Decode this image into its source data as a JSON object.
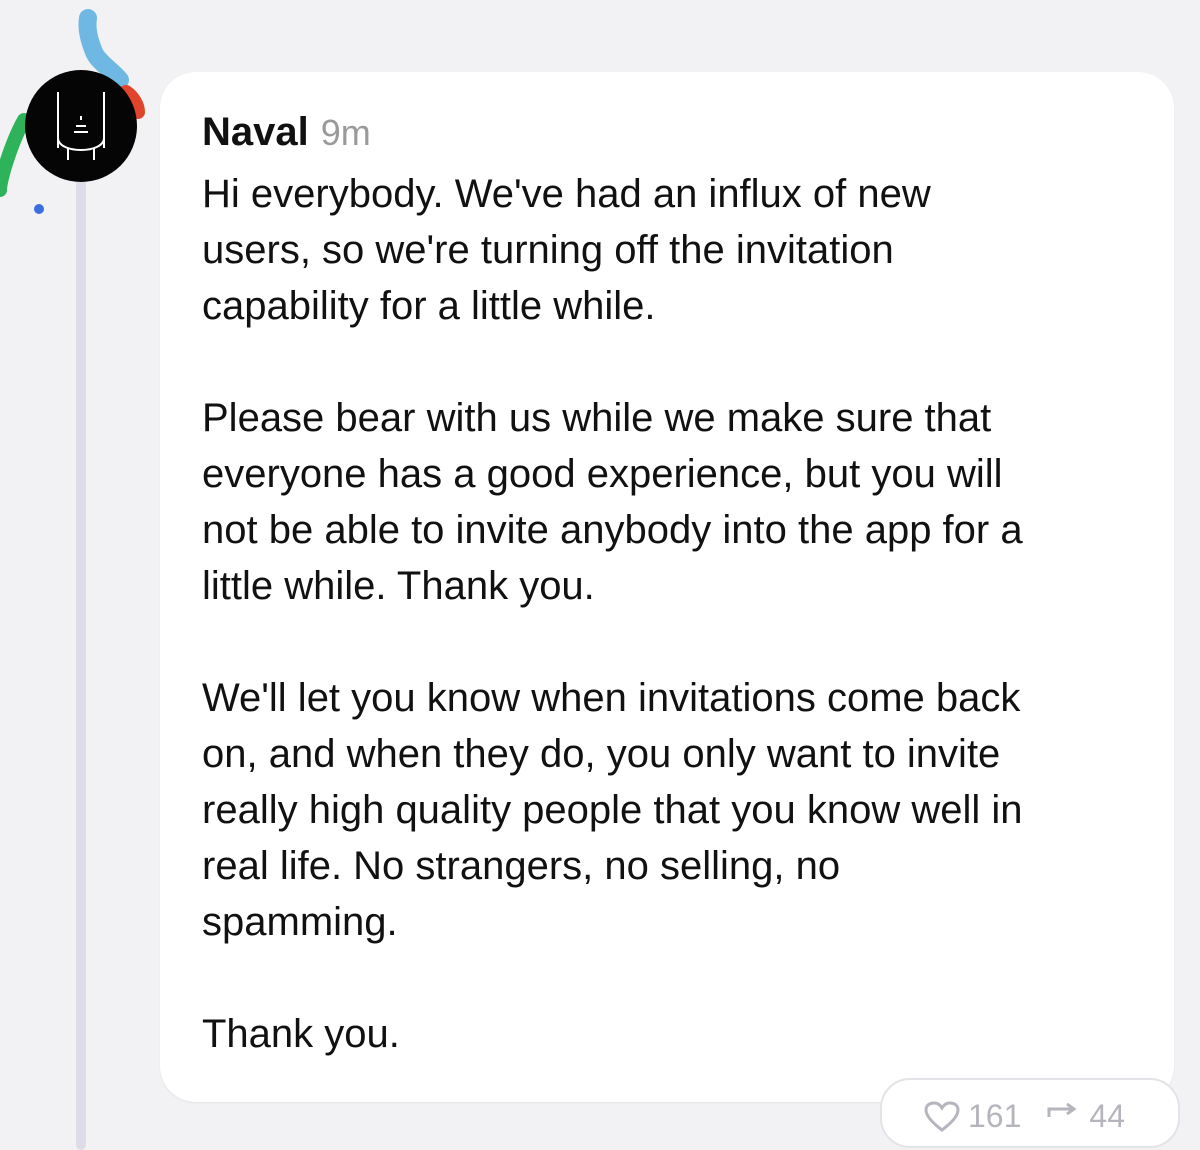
{
  "post": {
    "author": "Naval",
    "time": "9m",
    "paragraphs": [
      "Hi everybody. We've had an influx of new\nusers, so we're turning off the invitation\ncapability for a little while.",
      "Please bear with us while we make sure that\neveryone has a good experience, but you will\nnot be able to invite anybody into the app for a\nlittle while. Thank you.",
      "We'll let you know when invitations come back\non, and when they do, you only want to invite\nreally high quality people that you know well in\nreal life. No strangers, no selling, no\nspamming.",
      "Thank you."
    ]
  },
  "reactions": {
    "likes": "161",
    "reposts": "44",
    "like_icon": "heart-icon",
    "repost_icon": "repost-icon"
  },
  "colors": {
    "background": "#f2f2f4",
    "card": "#ffffff",
    "text": "#111111",
    "muted": "#9a9a9a",
    "thread_line": "#dcdde6",
    "avatar_ring_blue": "#6fb8e4",
    "avatar_ring_red": "#e0452b",
    "avatar_ring_green": "#2fb35a",
    "unread_dot": "#3a6fe0"
  }
}
